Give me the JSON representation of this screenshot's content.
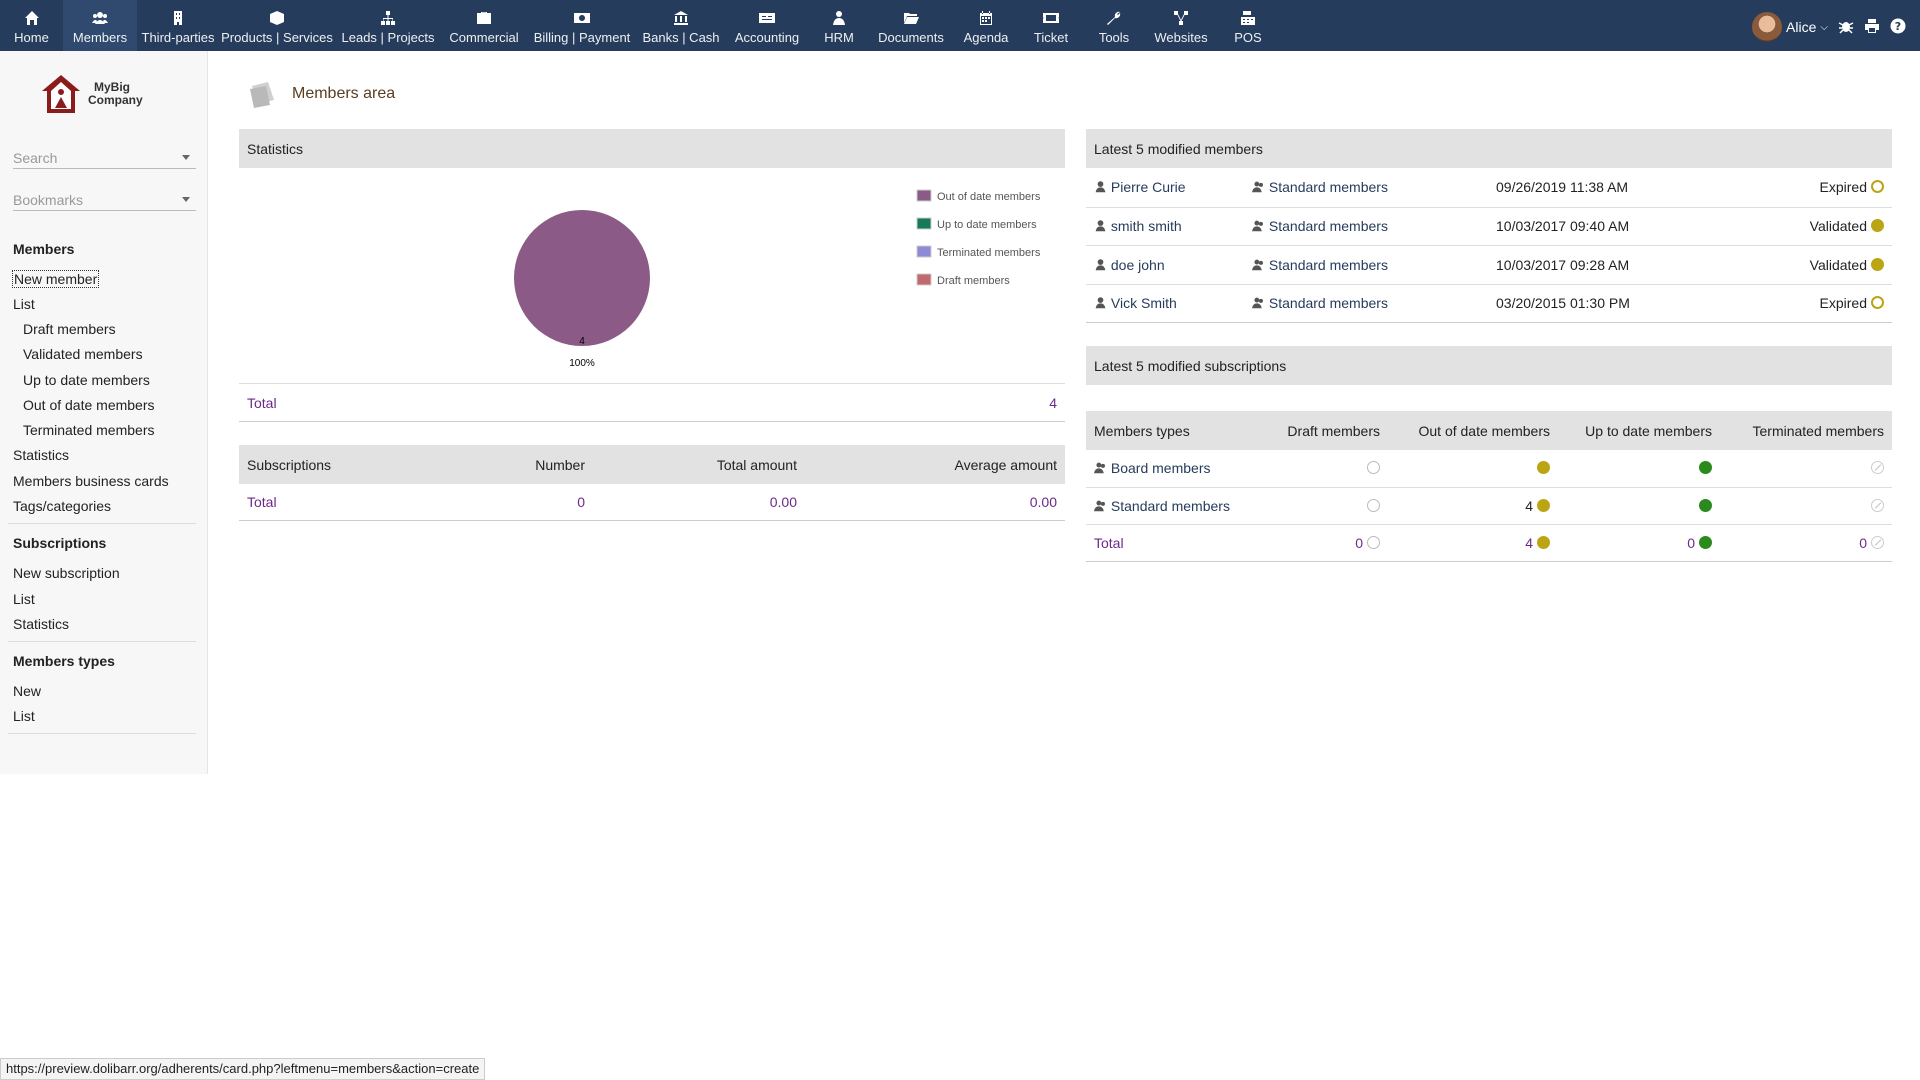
{
  "topnav": [
    {
      "label": "Home",
      "icon": "home-icon"
    },
    {
      "label": "Members",
      "icon": "users-icon",
      "active": true
    },
    {
      "label": "Third-parties",
      "icon": "building-icon"
    },
    {
      "label": "Products | Services",
      "icon": "cube-icon"
    },
    {
      "label": "Leads | Projects",
      "icon": "sitemap-icon"
    },
    {
      "label": "Commercial",
      "icon": "suitcase-icon"
    },
    {
      "label": "Billing | Payment",
      "icon": "money-bill-icon"
    },
    {
      "label": "Banks | Cash",
      "icon": "bank-icon"
    },
    {
      "label": "Accounting",
      "icon": "dollar-card-icon"
    },
    {
      "label": "HRM",
      "icon": "person-tie-icon"
    },
    {
      "label": "Documents",
      "icon": "folder-open-icon"
    },
    {
      "label": "Agenda",
      "icon": "calendar-icon"
    },
    {
      "label": "Ticket",
      "icon": "ticket-icon"
    },
    {
      "label": "Tools",
      "icon": "wrench-icon"
    },
    {
      "label": "Websites",
      "icon": "network-icon"
    },
    {
      "label": "POS",
      "icon": "cash-register-icon"
    }
  ],
  "user": {
    "name": "Alice"
  },
  "logo": {
    "line1": "MyBig",
    "line2": "Company"
  },
  "sidebar": {
    "search_placeholder": "Search",
    "bookmarks_placeholder": "Bookmarks",
    "members_head": "Members",
    "new_member": "New member",
    "list": "List",
    "draft": "Draft members",
    "validated": "Validated members",
    "uptodate": "Up to date members",
    "outofdate": "Out of date members",
    "terminated": "Terminated members",
    "statistics": "Statistics",
    "cards": "Members business cards",
    "tags": "Tags/categories",
    "subs_head": "Subscriptions",
    "new_sub": "New subscription",
    "subs_list": "List",
    "subs_stats": "Statistics",
    "types_head": "Members types",
    "types_new": "New",
    "types_list": "List"
  },
  "page_title": "Members area",
  "stats": {
    "title": "Statistics",
    "total_label": "Total",
    "total_value": "4",
    "pie_label": "4",
    "pie_pct": "100%",
    "legend": [
      {
        "label": "Out of date members",
        "color": "#8b5a86"
      },
      {
        "label": "Up to date members",
        "color": "#167a5a"
      },
      {
        "label": "Terminated members",
        "color": "#8f8ad6"
      },
      {
        "label": "Draft members",
        "color": "#c0696e"
      }
    ]
  },
  "chart_data": {
    "type": "pie",
    "labels": [
      "Out of date members",
      "Up to date members",
      "Terminated members",
      "Draft members"
    ],
    "values": [
      4,
      0,
      0,
      0
    ],
    "title": "",
    "legend": "right"
  },
  "subscriptions": {
    "headers": [
      "Subscriptions",
      "Number",
      "Total amount",
      "Average amount"
    ],
    "total_label": "Total",
    "number": "0",
    "total_amount": "0.00",
    "average_amount": "0.00"
  },
  "latest_members": {
    "title": "Latest 5 modified members",
    "rows": [
      {
        "name": "Pierre Curie",
        "type": "Standard members",
        "date": "09/26/2019 11:38 AM",
        "status": "Expired",
        "status_dot": "ring"
      },
      {
        "name": "smith smith",
        "type": "Standard members",
        "date": "10/03/2017 09:40 AM",
        "status": "Validated",
        "status_dot": "yellow"
      },
      {
        "name": "doe john",
        "type": "Standard members",
        "date": "10/03/2017 09:28 AM",
        "status": "Validated",
        "status_dot": "yellow"
      },
      {
        "name": "Vick Smith",
        "type": "Standard members",
        "date": "03/20/2015 01:30 PM",
        "status": "Expired",
        "status_dot": "ring"
      }
    ]
  },
  "latest_subs": {
    "title": "Latest 5 modified subscriptions"
  },
  "types_table": {
    "headers": [
      "Members types",
      "Draft members",
      "Out of date members",
      "Up to date members",
      "Terminated members"
    ],
    "rows": [
      {
        "name": "Board members",
        "draft": "",
        "outofdate": "",
        "uptodate": "",
        "terminated": ""
      },
      {
        "name": "Standard members",
        "draft": "",
        "outofdate": "4",
        "uptodate": "",
        "terminated": ""
      }
    ],
    "total": {
      "label": "Total",
      "draft": "0",
      "outofdate": "4",
      "uptodate": "0",
      "terminated": "0"
    }
  },
  "statusbar": "https://preview.dolibarr.org/adherents/card.php?leftmenu=members&action=create"
}
